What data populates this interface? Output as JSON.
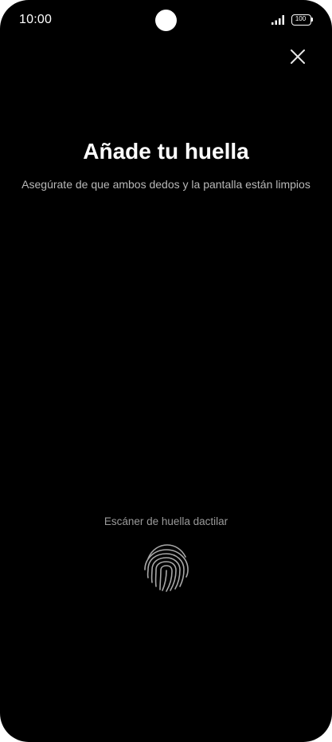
{
  "status_bar": {
    "time": "10:00",
    "battery_level": "100",
    "icons": [
      "signal-icon",
      "battery-icon"
    ]
  },
  "header": {
    "close_icon": "close-icon"
  },
  "main": {
    "title": "Añade tu huella",
    "subtitle": "Asegúrate de que ambos dedos y la pantalla están limpios"
  },
  "scanner": {
    "label": "Escáner de huella dactilar",
    "icon": "fingerprint-icon"
  },
  "colors": {
    "background": "#000000",
    "text_primary": "#ffffff",
    "text_secondary": "#b8b8b8",
    "fingerprint": "#a8a8a8"
  }
}
